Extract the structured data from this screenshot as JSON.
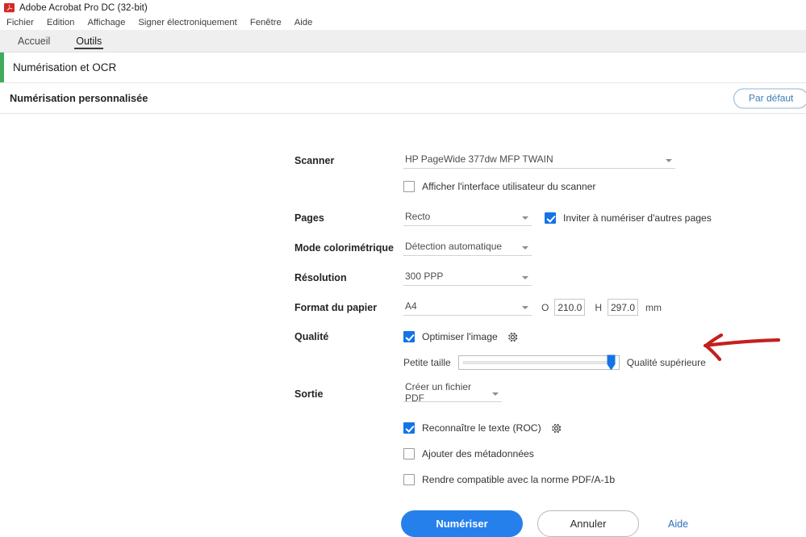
{
  "window": {
    "title": "Adobe Acrobat Pro DC (32-bit)",
    "logo_icon": "acrobat-logo-icon"
  },
  "menubar": {
    "items": [
      {
        "label": "Fichier"
      },
      {
        "label": "Edition"
      },
      {
        "label": "Affichage"
      },
      {
        "label": "Signer électroniquement"
      },
      {
        "label": "Fenêtre"
      },
      {
        "label": "Aide"
      }
    ]
  },
  "tabs": [
    {
      "label": "Accueil",
      "active": false
    },
    {
      "label": "Outils",
      "active": true
    }
  ],
  "tool_header": {
    "title": "Numérisation et OCR",
    "accent_color": "#3fab5b"
  },
  "sub_header": {
    "title": "Numérisation personnalisée",
    "default_button": "Par défaut"
  },
  "form": {
    "scanner": {
      "label": "Scanner",
      "value": "HP PageWide 377dw MFP TWAIN",
      "show_ui_checkbox": {
        "label": "Afficher l'interface utilisateur du scanner",
        "checked": false
      }
    },
    "pages": {
      "label": "Pages",
      "value": "Recto",
      "prompt_checkbox": {
        "label": "Inviter à numériser d'autres pages",
        "checked": true
      }
    },
    "color_mode": {
      "label": "Mode colorimétrique",
      "value": "Détection automatique"
    },
    "resolution": {
      "label": "Résolution",
      "value": "300 PPP"
    },
    "paper_size": {
      "label": "Format du papier",
      "value": "A4",
      "width_letter": "O",
      "width_value": "210.0",
      "height_letter": "H",
      "height_value": "297.0",
      "unit": "mm"
    },
    "quality": {
      "label": "Qualité",
      "optimize_checkbox": {
        "label": "Optimiser l'image",
        "checked": true
      },
      "settings_icon": "gear-icon",
      "slider": {
        "min_label": "Petite taille",
        "max_label": "Qualité supérieure",
        "value_percent": 93
      }
    },
    "output": {
      "label": "Sortie",
      "value": "Créer un fichier PDF"
    },
    "options": [
      {
        "label": "Reconnaître le texte (ROC)",
        "checked": true,
        "has_settings": true
      },
      {
        "label": "Ajouter des métadonnées",
        "checked": false,
        "has_settings": false
      },
      {
        "label": "Rendre compatible avec la norme PDF/A-1b",
        "checked": false,
        "has_settings": false
      }
    ]
  },
  "actions": {
    "scan": "Numériser",
    "cancel": "Annuler",
    "help": "Aide"
  },
  "annotation": {
    "arrow_color": "#c4201e",
    "arrow_direction": "left"
  },
  "colors": {
    "accent_blue": "#2680eb",
    "checkbox_blue": "#1473e6",
    "green_accent": "#3fab5b",
    "annotation_red": "#c4201e"
  }
}
